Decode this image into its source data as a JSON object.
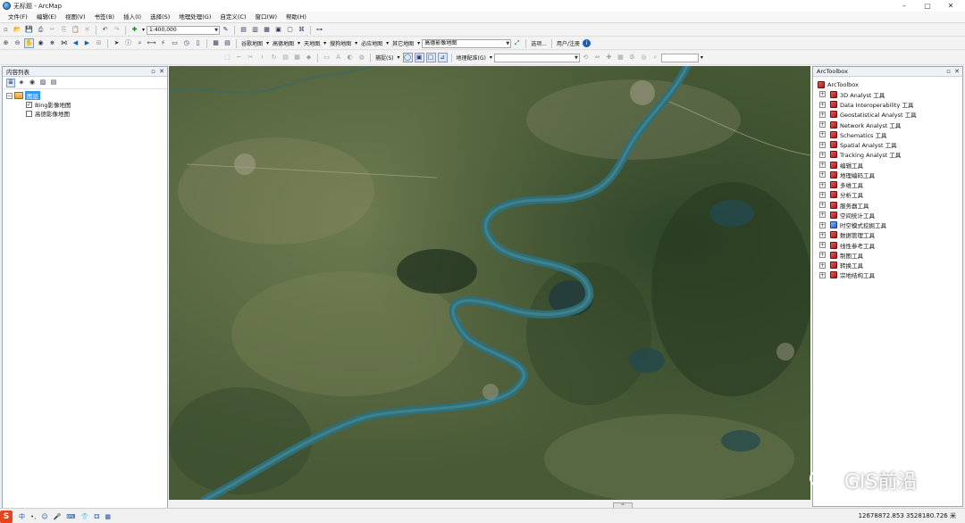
{
  "window": {
    "title": "无标题 - ArcMap",
    "controls": [
      "–",
      "▢",
      "✕"
    ]
  },
  "menubar": {
    "items": [
      "文件(F)",
      "编辑(E)",
      "视图(V)",
      "书签(B)",
      "插入(I)",
      "选择(S)",
      "地理处理(G)",
      "自定义(C)",
      "窗口(W)",
      "帮助(H)"
    ]
  },
  "toolbar": {
    "scale_value": "1:400,000",
    "basemaps": {
      "gusong": "谷歌地图",
      "gaode": "高德地图",
      "tianditu": "天地图",
      "sogou": "搜狗地图",
      "bigemap": "必应地图",
      "other": "其它地图",
      "current_layer": "高德影像地图"
    },
    "options_label": "选项...",
    "user_notes_label": "用户/注册",
    "snapping_label": "捕捉(S)",
    "georef_label": "地理配准(G)"
  },
  "toc": {
    "title": "内容列表",
    "group_label": "图层",
    "layers": [
      {
        "label": "Bing影像地图",
        "checked": true
      },
      {
        "label": "高德影像地图",
        "checked": false
      }
    ]
  },
  "toolbox": {
    "title": "ArcToolbox",
    "root_label": "ArcToolbox",
    "items": [
      "3D Analyst 工具",
      "Data Interoperability 工具",
      "Geostatistical Analyst 工具",
      "Network Analyst 工具",
      "Schematics 工具",
      "Spatial Analyst 工具",
      "Tracking Analyst 工具",
      "编辑工具",
      "地理编码工具",
      "多维工具",
      "分析工具",
      "服务器工具",
      "空间统计工具",
      "时空模式挖掘工具",
      "数据管理工具",
      "线性参考工具",
      "制图工具",
      "转换工具",
      "宗地结构工具"
    ]
  },
  "status": {
    "coordinates": "12678872.853  3528180.726 米"
  },
  "ime": {
    "logo": "S",
    "items": [
      "中",
      "•,",
      "☺",
      "🎤",
      "⌨",
      "👕",
      "⚃",
      "▦"
    ]
  },
  "watermark": {
    "text": "GIS前沿"
  },
  "colors": {
    "river": "#2f6f7a",
    "land": "#5b6b44",
    "selection": "#3399ff",
    "toolbox_icon": "#c02020"
  }
}
